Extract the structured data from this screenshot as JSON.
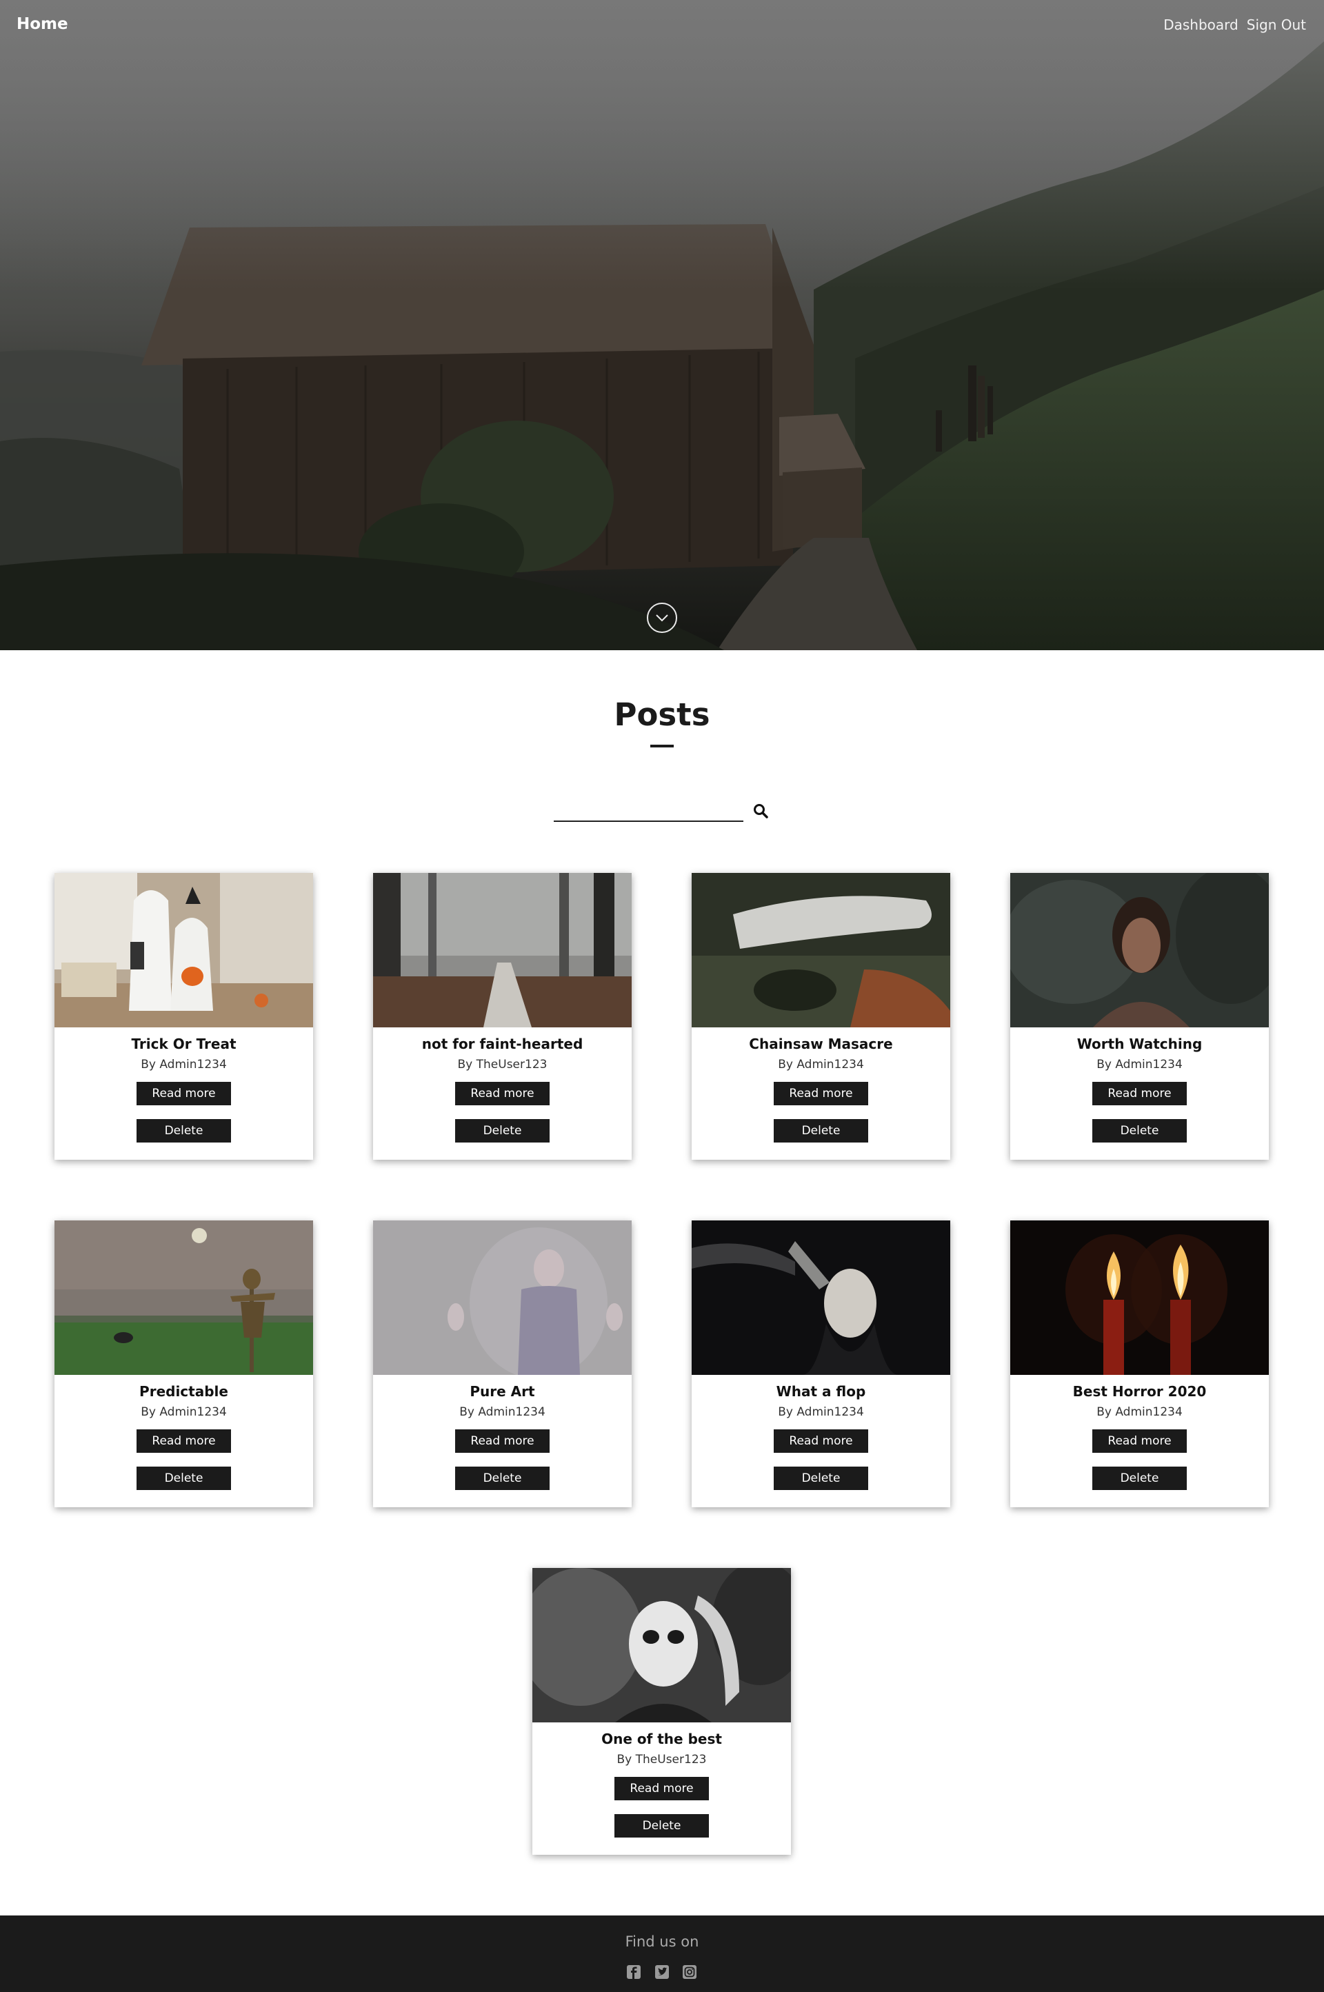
{
  "nav": {
    "home": "Home",
    "dashboard": "Dashboard",
    "sign_out": "Sign Out"
  },
  "hero": {
    "scroll_icon": "chevron-down-icon"
  },
  "posts": {
    "title": "Posts",
    "search": {
      "value": "",
      "placeholder": "",
      "icon": "search-icon"
    },
    "items": [
      {
        "title": "Trick Or Treat",
        "author": "By Admin1234",
        "read": "Read more",
        "delete": "Delete"
      },
      {
        "title": "not for faint-hearted",
        "author": "By TheUser123",
        "read": "Read more",
        "delete": "Delete"
      },
      {
        "title": "Chainsaw Masacre",
        "author": "By Admin1234",
        "read": "Read more",
        "delete": "Delete"
      },
      {
        "title": "Worth Watching",
        "author": "By Admin1234",
        "read": "Read more",
        "delete": "Delete"
      },
      {
        "title": "Predictable",
        "author": "By Admin1234",
        "read": "Read more",
        "delete": "Delete"
      },
      {
        "title": "Pure Art",
        "author": "By Admin1234",
        "read": "Read more",
        "delete": "Delete"
      },
      {
        "title": "What a flop",
        "author": "By Admin1234",
        "read": "Read more",
        "delete": "Delete"
      },
      {
        "title": "Best Horror 2020",
        "author": "By Admin1234",
        "read": "Read more",
        "delete": "Delete"
      },
      {
        "title": "One of the best",
        "author": "By TheUser123",
        "read": "Read more",
        "delete": "Delete"
      }
    ]
  },
  "footer": {
    "text": "Find us on",
    "icons": [
      "facebook-icon",
      "twitter-icon",
      "instagram-icon"
    ]
  },
  "colors": {
    "button_bg": "#1b1b1b",
    "footer_bg": "#1b1b1b",
    "text": "#111111"
  }
}
